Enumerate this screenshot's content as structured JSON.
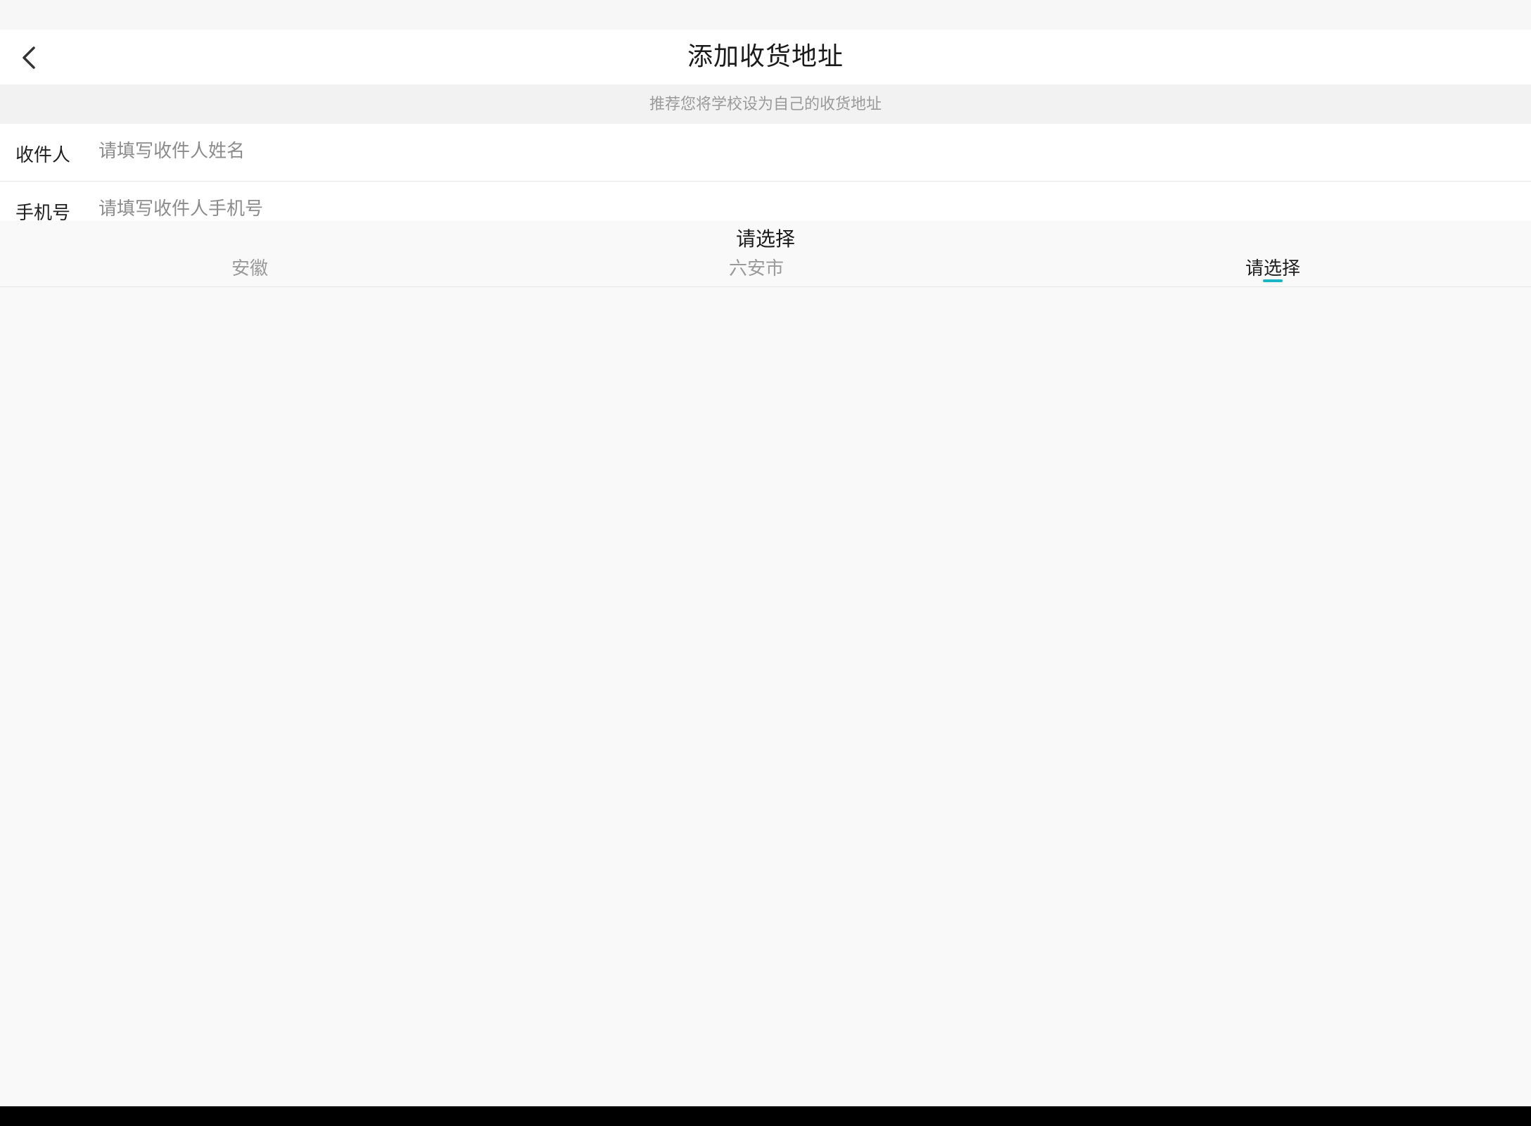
{
  "header": {
    "title": "添加收货地址",
    "back_icon": "chevron-left-icon"
  },
  "hint": {
    "text": "推荐您将学校设为自己的收货地址"
  },
  "form": {
    "recipient": {
      "label": "收件人",
      "placeholder": "请填写收件人姓名",
      "value": ""
    },
    "phone": {
      "label": "手机号",
      "placeholder": "请填写收件人手机号",
      "value": ""
    }
  },
  "region_picker": {
    "title": "请选择",
    "tabs": [
      {
        "label": "安徽",
        "active": false
      },
      {
        "label": "六安市",
        "active": false
      },
      {
        "label": "请选择",
        "active": true
      }
    ]
  },
  "colors": {
    "accent": "#1bb5c4",
    "background": "#f9f9f9",
    "hint_text": "#9a9a9a"
  }
}
